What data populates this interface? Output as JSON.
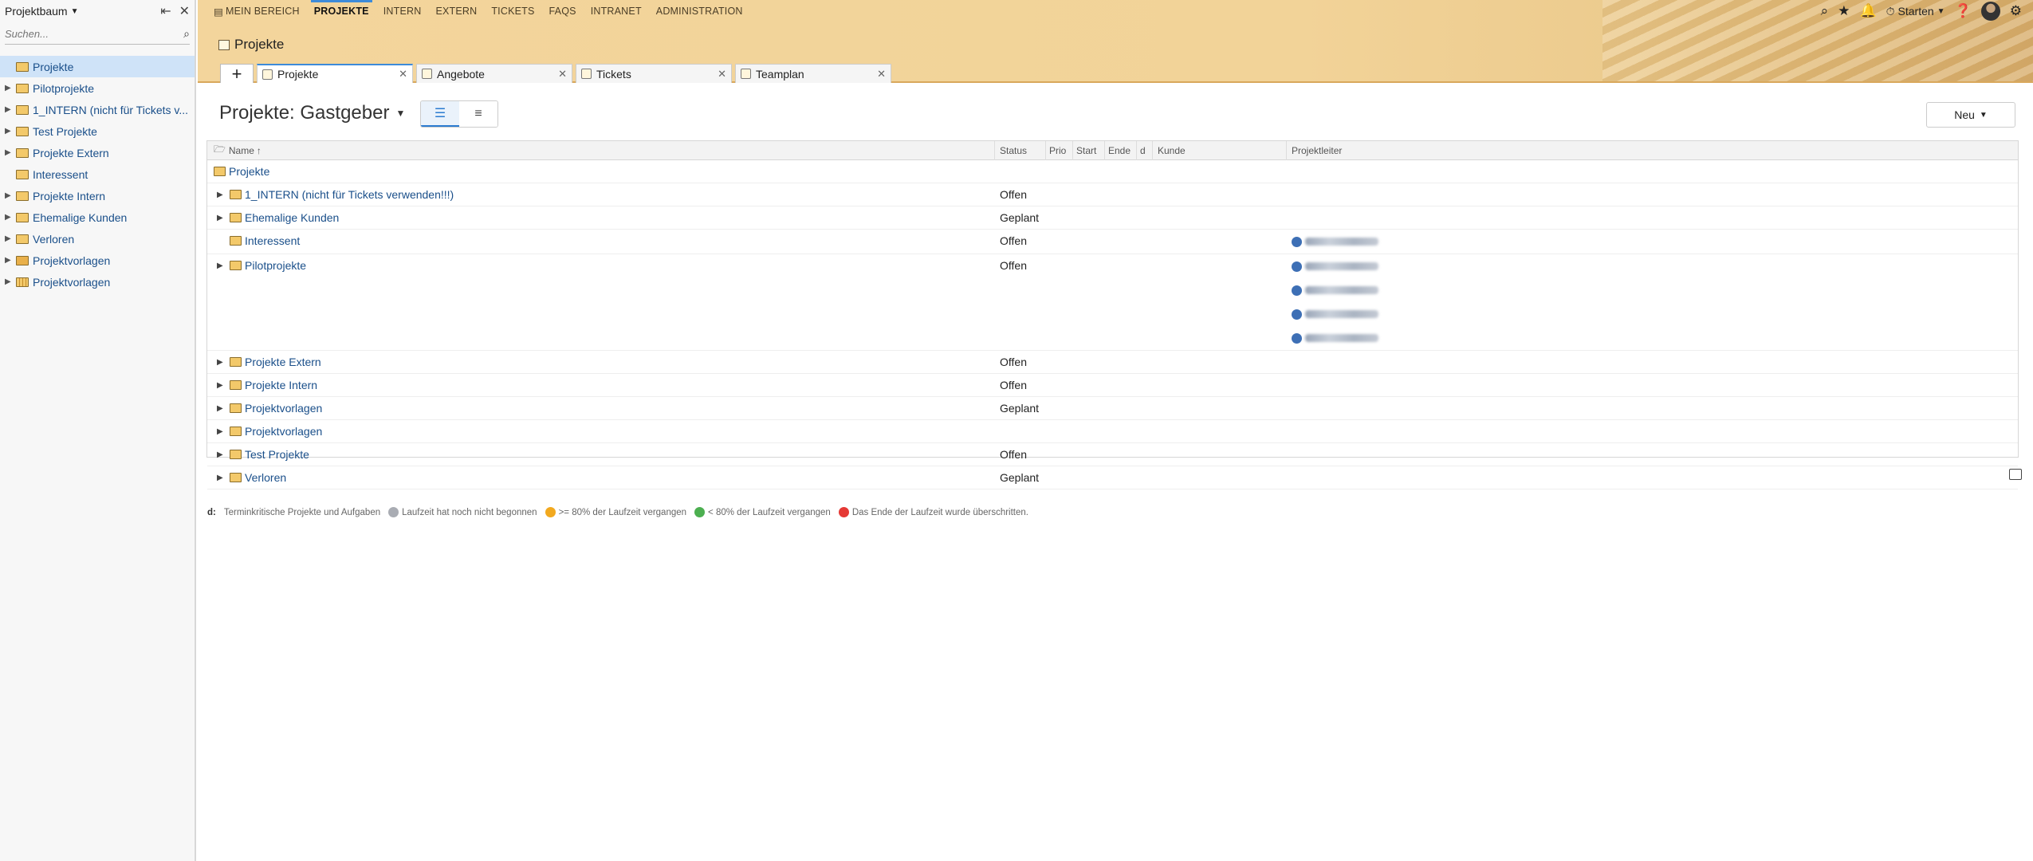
{
  "sidebar": {
    "title": "Projektbaum",
    "search_placeholder": "Suchen...",
    "items": [
      {
        "label": "Projekte",
        "selected": true,
        "toggle": ""
      },
      {
        "label": "Pilotprojekte",
        "toggle": "▶"
      },
      {
        "label": "1_INTERN (nicht für Tickets v...",
        "toggle": "▶"
      },
      {
        "label": "Test Projekte",
        "toggle": "▶"
      },
      {
        "label": "Projekte Extern",
        "toggle": "▶"
      },
      {
        "label": "Interessent",
        "toggle": ""
      },
      {
        "label": "Projekte Intern",
        "toggle": "▶"
      },
      {
        "label": "Ehemalige Kunden",
        "toggle": "▶"
      },
      {
        "label": "Verloren",
        "toggle": "▶"
      },
      {
        "label": "Projektvorlagen",
        "toggle": "▶"
      },
      {
        "label": "Projektvorlagen",
        "toggle": "▶"
      }
    ]
  },
  "topnav": {
    "items": [
      "MEIN BEREICH",
      "PROJEKTE",
      "INTERN",
      "EXTERN",
      "TICKETS",
      "FAQS",
      "INTRANET",
      "ADMINISTRATION"
    ],
    "active": "PROJEKTE",
    "start_label": "Starten"
  },
  "header": {
    "page_title": "Projekte"
  },
  "tabs": [
    {
      "label": "Projekte",
      "active": true
    },
    {
      "label": "Angebote"
    },
    {
      "label": "Tickets"
    },
    {
      "label": "Teamplan"
    }
  ],
  "main": {
    "view_title": "Projekte: Gastgeber",
    "new_button": "Neu",
    "columns": {
      "name": "Name",
      "status": "Status",
      "prio": "Prio",
      "start": "Start",
      "ende": "Ende",
      "d": "d",
      "kunde": "Kunde",
      "projektleiter": "Projektleiter"
    },
    "rows": [
      {
        "label": "Projekte",
        "status": "",
        "toggle": "",
        "root": true,
        "leaders": 0
      },
      {
        "label": "1_INTERN (nicht für Tickets verwenden!!!)",
        "status": "Offen",
        "toggle": "▶",
        "leaders": 0
      },
      {
        "label": "Ehemalige Kunden",
        "status": "Geplant",
        "toggle": "▶",
        "leaders": 0
      },
      {
        "label": "Interessent",
        "status": "Offen",
        "toggle": "",
        "leaders": 1
      },
      {
        "label": "Pilotprojekte",
        "status": "Offen",
        "toggle": "▶",
        "leaders": 4
      },
      {
        "label": "Projekte Extern",
        "status": "Offen",
        "toggle": "▶",
        "leaders": 0
      },
      {
        "label": "Projekte Intern",
        "status": "Offen",
        "toggle": "▶",
        "leaders": 0
      },
      {
        "label": "Projektvorlagen",
        "status": "Geplant",
        "toggle": "▶",
        "leaders": 0
      },
      {
        "label": "Projektvorlagen",
        "status": "",
        "toggle": "▶",
        "leaders": 0
      },
      {
        "label": "Test Projekte",
        "status": "Offen",
        "toggle": "▶",
        "leaders": 0
      },
      {
        "label": "Verloren",
        "status": "Geplant",
        "toggle": "▶",
        "leaders": 0
      }
    ]
  },
  "legend": {
    "key": "d:",
    "items": [
      {
        "text": "Terminkritische Projekte und Aufgaben",
        "color": ""
      },
      {
        "text": "Laufzeit hat noch nicht begonnen",
        "color": "#a9acb3"
      },
      {
        "text": ">= 80% der Laufzeit vergangen",
        "color": "#f2a91f"
      },
      {
        "text": "< 80% der Laufzeit vergangen",
        "color": "#4caf50"
      },
      {
        "text": "Das Ende der Laufzeit wurde überschritten.",
        "color": "#e53935"
      }
    ]
  }
}
